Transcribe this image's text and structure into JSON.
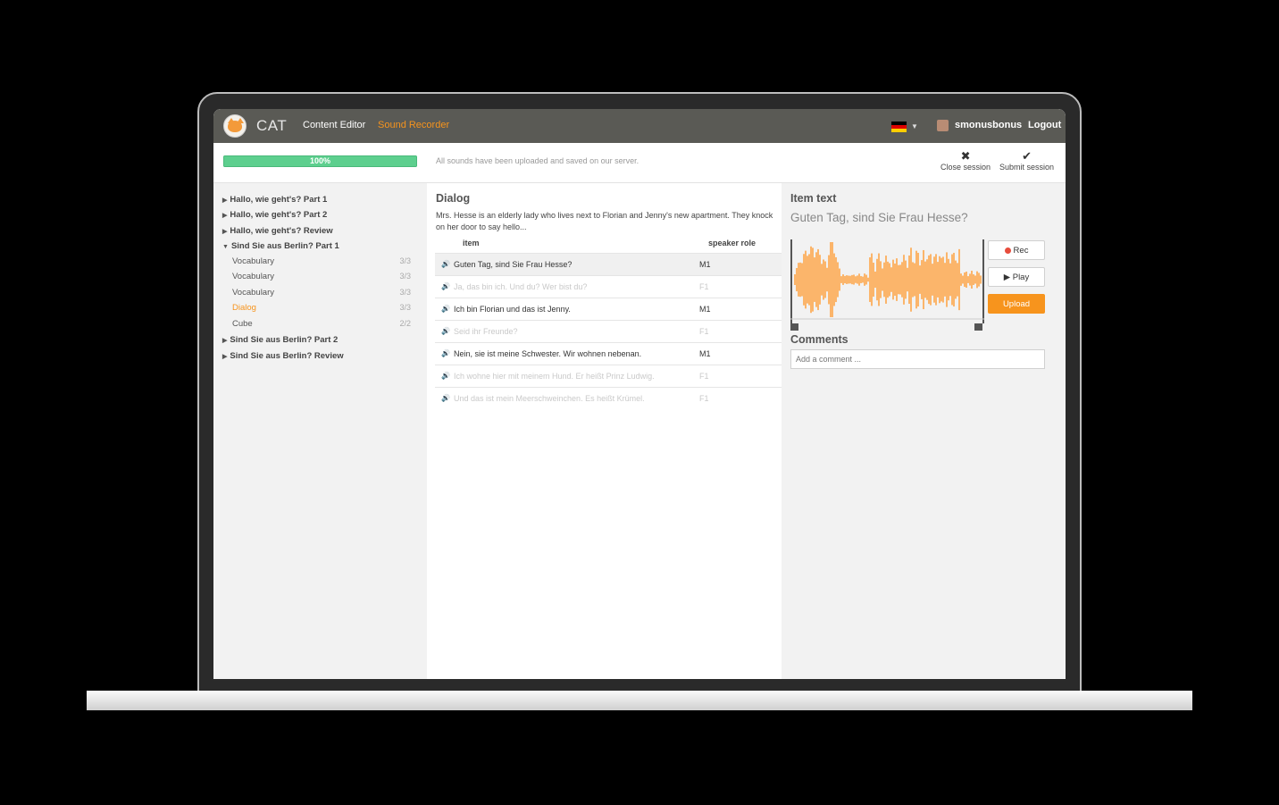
{
  "app": {
    "brand": "CAT"
  },
  "nav": {
    "content_editor": "Content Editor",
    "sound_recorder": "Sound Recorder",
    "username": "smonusbonus",
    "logout": "Logout",
    "active_color": "#f7941d"
  },
  "status": {
    "progress": 1.0,
    "progress_label": "100%",
    "message": "All sounds have been uploaded and saved on our server.",
    "close_session": "Close session",
    "submit_session": "Submit session"
  },
  "sidebar": {
    "lessons": [
      {
        "label": "Hallo, wie geht's? Part 1",
        "expanded": false
      },
      {
        "label": "Hallo, wie geht's? Part 2",
        "expanded": false
      },
      {
        "label": "Hallo, wie geht's? Review",
        "expanded": false
      },
      {
        "label": "Sind Sie aus Berlin? Part 1",
        "expanded": true
      },
      {
        "label": "Sind Sie aus Berlin? Part 2",
        "expanded": false
      },
      {
        "label": "Sind Sie aus Berlin? Review",
        "expanded": false
      }
    ],
    "subitems": [
      {
        "label": "Vocabulary",
        "count": "3/3"
      },
      {
        "label": "Vocabulary",
        "count": "3/3"
      },
      {
        "label": "Vocabulary",
        "count": "3/3"
      },
      {
        "label": "Dialog",
        "count": "3/3",
        "active": true
      },
      {
        "label": "Cube",
        "count": "2/2"
      }
    ]
  },
  "dialog": {
    "title": "Dialog",
    "description": "Mrs. Hesse is an elderly lady who lives next to Florian and Jenny's new apartment. They knock on her door to say hello...",
    "col_item": "item",
    "col_role": "speaker role",
    "rows": [
      {
        "text": "Guten Tag, sind Sie Frau Hesse?",
        "role": "M1",
        "selected": true,
        "dim": false
      },
      {
        "text": "Ja, das bin ich. Und du? Wer bist du?",
        "role": "F1",
        "dim": true
      },
      {
        "text": "Ich bin Florian und das ist Jenny.",
        "role": "M1",
        "dim": false
      },
      {
        "text": "Seid ihr Freunde?",
        "role": "F1",
        "dim": true
      },
      {
        "text": "Nein, sie ist meine Schwester. Wir wohnen nebenan.",
        "role": "M1",
        "dim": false
      },
      {
        "text": "Ich wohne hier mit meinem Hund. Er heißt Prinz Ludwig.",
        "role": "F1",
        "dim": true
      },
      {
        "text": "Und das ist mein Meerschweinchen. Es heißt Krümel.",
        "role": "F1",
        "dim": true
      }
    ]
  },
  "item_panel": {
    "label": "Item text",
    "text": "Guten Tag, sind Sie Frau Hesse?",
    "rec": "Rec",
    "play": "Play",
    "upload": "Upload",
    "comments_label": "Comments",
    "comment_placeholder": "Add a comment ...",
    "waveform_color": "#fbb56b"
  }
}
